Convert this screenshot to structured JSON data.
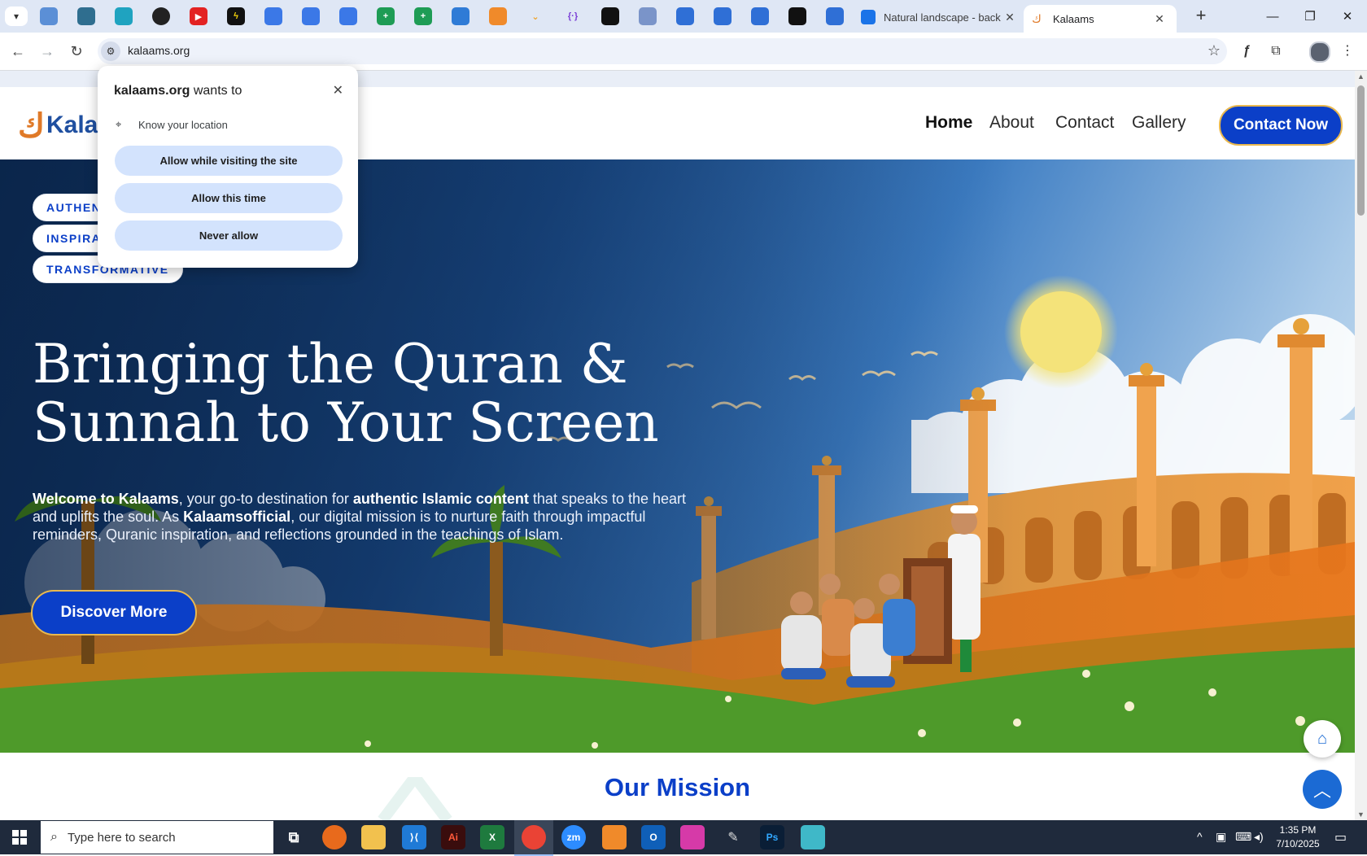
{
  "browser": {
    "tabs": [
      {
        "title": "Natural landscape - back",
        "active": false
      },
      {
        "title": "Kalaams",
        "active": true
      }
    ],
    "url": "kalaams.org"
  },
  "permission_popup": {
    "site": "kalaams.org",
    "wants_to": "wants to",
    "request": "Know your location",
    "buttons": [
      "Allow while visiting the site",
      "Allow this time",
      "Never allow"
    ]
  },
  "site": {
    "logo_text": "Kalaams",
    "nav": [
      "Home",
      "About",
      "Contact",
      "Gallery"
    ],
    "cta": "Contact Now"
  },
  "hero": {
    "badges": [
      "AUTHENTIC",
      "INSPIRATIONAL",
      "TRANSFORMATIVE"
    ],
    "title_line1": "Bringing the Quran &",
    "title_line2": "Sunnah to Your Screen",
    "text": {
      "p1_bold": "Welcome to Kalaams",
      "p1": ", your go-to destination for ",
      "p2_bold": "authentic Islamic content",
      "p2": " that speaks to the heart and uplifts the soul. As ",
      "p3_bold": "Kalaamsofficial",
      "p3": ", our digital mission is to nurture faith through impactful reminders, Quranic inspiration, and reflections grounded in the teachings of Islam."
    },
    "button": "Discover More"
  },
  "mission": {
    "title": "Our Mission"
  },
  "taskbar": {
    "search_placeholder": "Type here to search",
    "time": "1:35 PM",
    "date": "7/10/2025"
  },
  "colors": {
    "brand_blue": "#0b3fc8",
    "accent_gold": "#e9b84e",
    "logo_orange": "#e07a28"
  }
}
